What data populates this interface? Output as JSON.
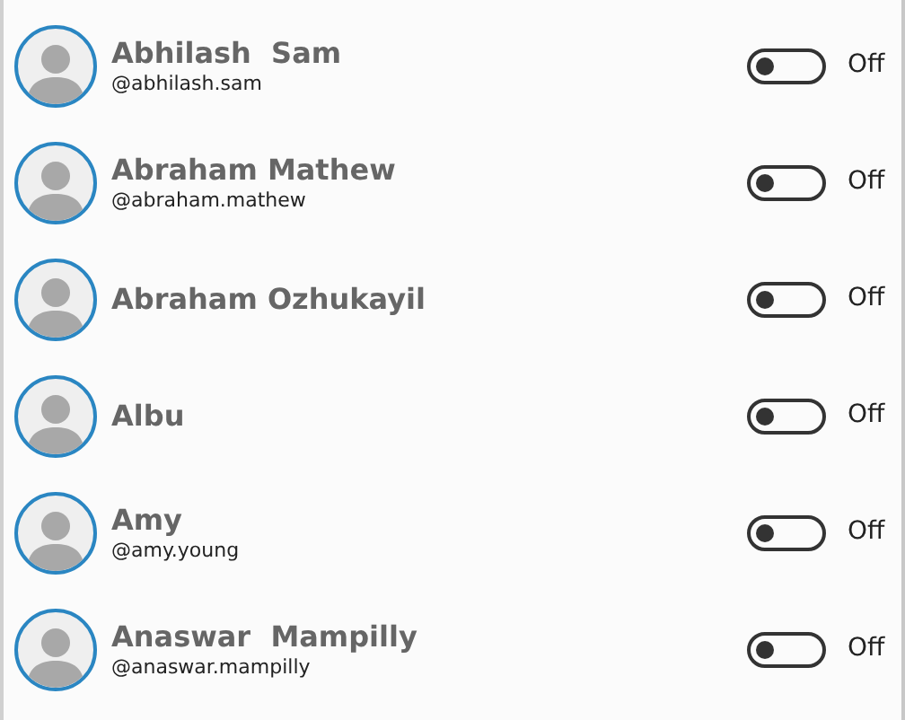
{
  "contacts": [
    {
      "name": "Abhilash  Sam",
      "handle": "@abhilash.sam",
      "on": false,
      "state_label": "Off"
    },
    {
      "name": "Abraham Mathew",
      "handle": "@abraham.mathew",
      "on": false,
      "state_label": "Off"
    },
    {
      "name": "Abraham Ozhukayil",
      "on": false,
      "state_label": "Off"
    },
    {
      "name": "Albu",
      "on": false,
      "state_label": "Off"
    },
    {
      "name": "Amy",
      "handle": "@amy.young",
      "on": false,
      "state_label": "Off"
    },
    {
      "name": "Anaswar  Mampilly",
      "handle": "@anaswar.mampilly",
      "on": false,
      "state_label": "Off"
    }
  ]
}
